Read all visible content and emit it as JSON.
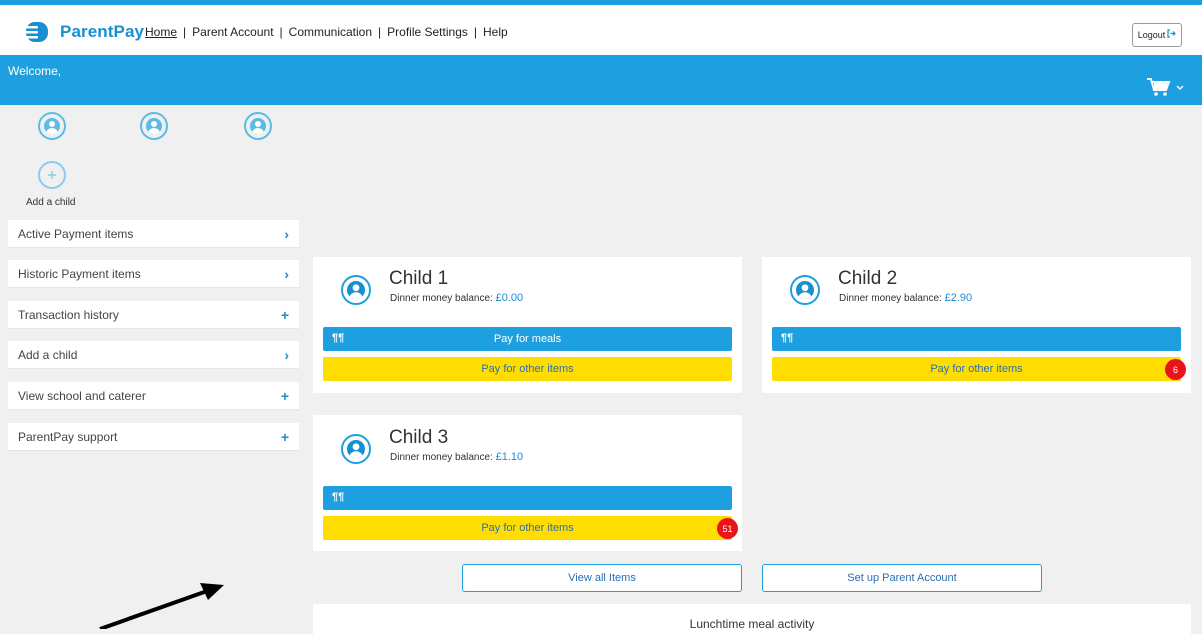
{
  "header": {
    "brand": "ParentPay",
    "nav": [
      {
        "label": "Home"
      },
      {
        "label": "Parent Account"
      },
      {
        "label": "Communication"
      },
      {
        "label": "Profile Settings"
      },
      {
        "label": "Help"
      }
    ],
    "logout_label": "Logout",
    "logout_icon": "sign-out-icon"
  },
  "welcome": {
    "text": "Welcome,",
    "cart_icon": "shopping-cart-icon"
  },
  "children_bar": {
    "add_child_label": "Add a child"
  },
  "sidebar": {
    "items": [
      {
        "label": "Active Payment items",
        "action": "›"
      },
      {
        "label": "Historic Payment items",
        "action": "›"
      },
      {
        "label": "Transaction history",
        "action": "+"
      },
      {
        "label": "Add a child",
        "action": "›"
      },
      {
        "label": "View school and caterer",
        "action": "+"
      },
      {
        "label": "ParentPay support",
        "action": "+"
      }
    ]
  },
  "cards": [
    {
      "name": "Child 1",
      "balance_label": "Dinner money balance:",
      "balance": "£0.00",
      "meals_label": "Pay for meals",
      "other_label": "Pay for other items",
      "badge": ""
    },
    {
      "name": "Child 2",
      "balance_label": "Dinner money balance:",
      "balance": "£2.90",
      "meals_label": "",
      "other_label": "Pay for other items",
      "badge": "6"
    },
    {
      "name": "Child 3",
      "balance_label": "Dinner money balance:",
      "balance": "£1.10",
      "meals_label": "",
      "other_label": "Pay for other items",
      "badge": "51"
    }
  ],
  "actions": {
    "view_all": "View all Items",
    "setup_account": "Set up Parent Account"
  },
  "activity": {
    "title": "Lunchtime meal activity"
  },
  "colors": {
    "brand_blue": "#1ea0e0",
    "accent_yellow": "#ffdd00",
    "badge_red": "#e8141a"
  }
}
